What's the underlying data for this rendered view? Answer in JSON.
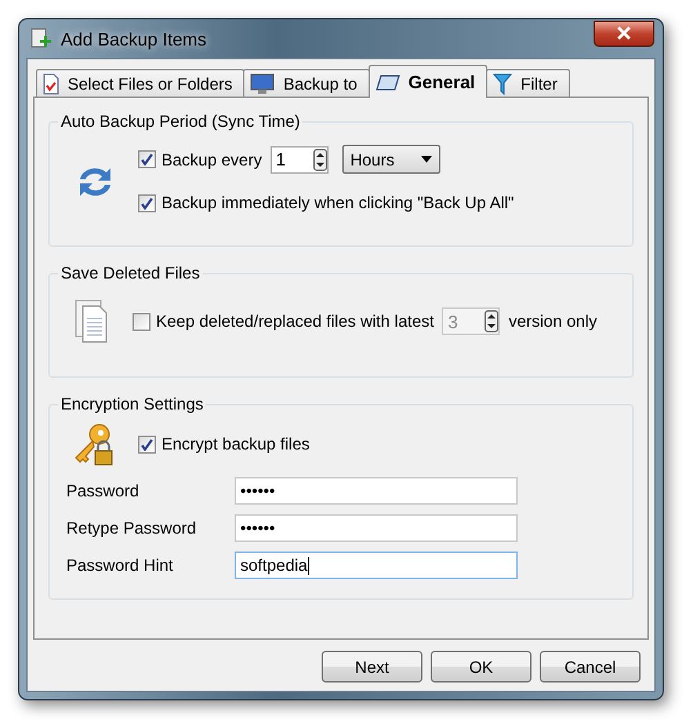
{
  "window": {
    "title": "Add Backup Items"
  },
  "tabs": [
    {
      "label": "Select Files or Folders",
      "selected": false
    },
    {
      "label": "Backup to",
      "selected": false
    },
    {
      "label": "General",
      "selected": true
    },
    {
      "label": "Filter",
      "selected": false
    }
  ],
  "auto_backup": {
    "title": "Auto Backup Period (Sync Time)",
    "backup_every": {
      "label": "Backup every",
      "checked": true,
      "value": "1",
      "unit": "Hours"
    },
    "immediate": {
      "label": "Backup immediately when clicking \"Back Up All\"",
      "checked": true
    }
  },
  "save_deleted": {
    "title": "Save Deleted Files",
    "keep": {
      "label": "Keep deleted/replaced files with latest",
      "checked": false,
      "value": "3",
      "disabled": true,
      "suffix": "version only"
    }
  },
  "encryption": {
    "title": "Encryption Settings",
    "encrypt": {
      "label": "Encrypt backup files",
      "checked": true
    },
    "fields": [
      {
        "label": "Password",
        "value": "••••••",
        "focused": false
      },
      {
        "label": "Retype Password",
        "value": "••••••",
        "focused": false
      },
      {
        "label": "Password Hint",
        "value": "softpedia",
        "focused": true
      }
    ]
  },
  "buttons": [
    "Next",
    "OK",
    "Cancel"
  ]
}
